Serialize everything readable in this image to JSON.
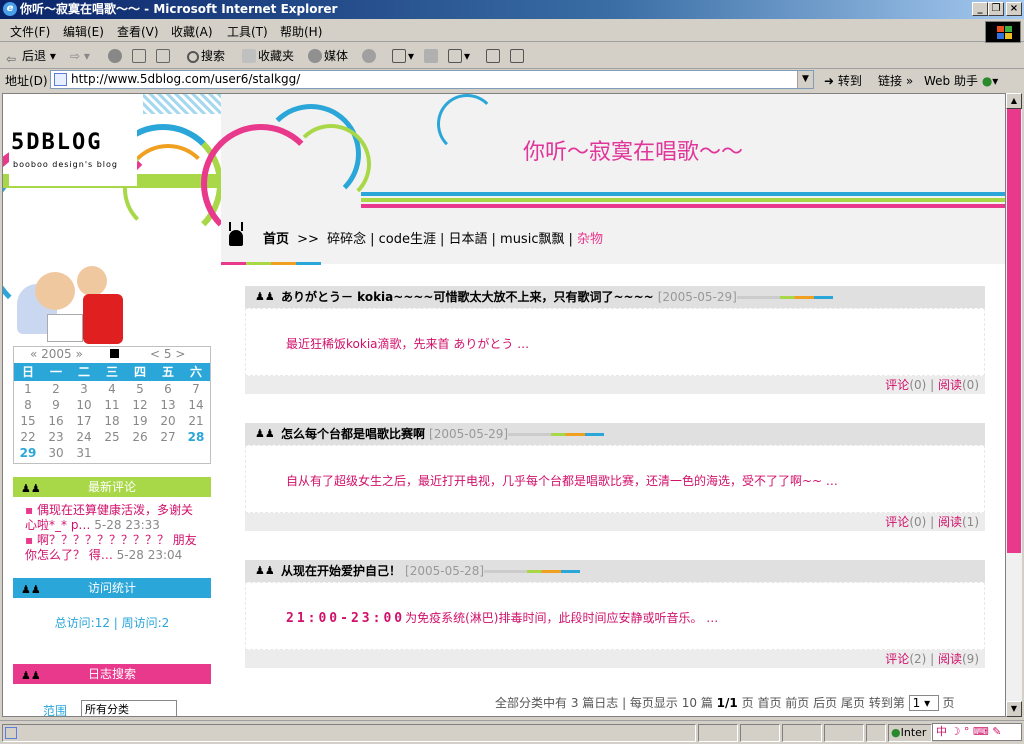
{
  "window": {
    "title": "你听～寂寞在唱歌～～ - Microsoft Internet Explorer"
  },
  "menu": [
    "文件(F)",
    "编辑(E)",
    "查看(V)",
    "收藏(A)",
    "工具(T)",
    "帮助(H)"
  ],
  "toolbar": {
    "back": "后退",
    "search": "搜索",
    "favorites": "收藏夹",
    "media": "媒体"
  },
  "address": {
    "label": "地址(D)",
    "url": "http://www.5dblog.com/user6/stalkgg/",
    "go": "转到",
    "links": "链接",
    "web_helper": "Web 助手"
  },
  "site": {
    "title": "你听～寂寞在唱歌～～",
    "logo_text": "5DBLOG",
    "logo_sub": "booboo design's blog"
  },
  "nav": {
    "home": "首页",
    "sep": ">>",
    "items": [
      "碎碎念",
      "code生涯",
      "日本語",
      "music飘飘",
      "杂物"
    ]
  },
  "calendar": {
    "year_nav": "« 2005 »",
    "month_nav": "< 5 >",
    "weekdays": [
      "日",
      "一",
      "二",
      "三",
      "四",
      "五",
      "六"
    ],
    "rows": [
      [
        "1",
        "2",
        "3",
        "4",
        "5",
        "6",
        "7"
      ],
      [
        "8",
        "9",
        "10",
        "11",
        "12",
        "13",
        "14"
      ],
      [
        "15",
        "16",
        "17",
        "18",
        "19",
        "20",
        "21"
      ],
      [
        "22",
        "23",
        "24",
        "25",
        "26",
        "27",
        "28"
      ],
      [
        "29",
        "30",
        "31",
        "",
        "",
        "",
        ""
      ]
    ],
    "highlight": [
      "28",
      "29"
    ]
  },
  "comments": {
    "title": "最新评论",
    "items": [
      {
        "text": "偶现在还算健康活泼，多谢关心啦*_* p…",
        "time": "5-28 23:33"
      },
      {
        "text": "啊？？？？？？？？？？ 朋友你怎么了？ 得…",
        "time": "5-28 23:04"
      }
    ]
  },
  "stats": {
    "title": "访问统计",
    "text": "总访问:12 | 周访问:2"
  },
  "search": {
    "title": "日志搜索",
    "scope_label": "范围",
    "scope_value": "所有分类"
  },
  "posts": [
    {
      "title": "ありがとう－ kokia~~~~可惜歌太大放不上来，只有歌词了~~~~",
      "date": "[2005-05-29]",
      "excerpt": "最近狂稀饭kokia滴歌，先来首 ありがとう …",
      "comment_label": "评论",
      "comments": "(0)",
      "read_label": "阅读",
      "reads": "(0)"
    },
    {
      "title": "怎么每个台都是唱歌比赛啊",
      "date": "[2005-05-29]",
      "excerpt": "自从有了超级女生之后，最近打开电视，几乎每个台都是唱歌比赛，还清一色的海选，受不了了啊~~ …",
      "comment_label": "评论",
      "comments": "(0)",
      "read_label": "阅读",
      "reads": "(1)"
    },
    {
      "title": "从现在开始爱护自己！",
      "date": "[2005-05-28]",
      "excerpt_highlight": "21:00-23:00",
      "excerpt": "为免疫系统(淋巴)排毒时间，此段时间应安静或听音乐。 …",
      "comment_label": "评论",
      "comments": "(2)",
      "read_label": "阅读",
      "reads": "(9)"
    }
  ],
  "pager": {
    "summary": "全部分类中有 3 篇日志 | 每页显示 10 篇",
    "pages": "1/1",
    "page_unit": "页",
    "first": "首页",
    "prev": "前页",
    "next": "后页",
    "last": "尾页",
    "jump": "转到第",
    "current": "1",
    "suffix": "页"
  },
  "status": {
    "zone": "Inter",
    "ime": "中"
  },
  "colors": {
    "pink": "#e8398c",
    "blue": "#2aa6d9",
    "green": "#a8d848",
    "orange": "#f0a020",
    "titlebar": "#0a246a"
  }
}
